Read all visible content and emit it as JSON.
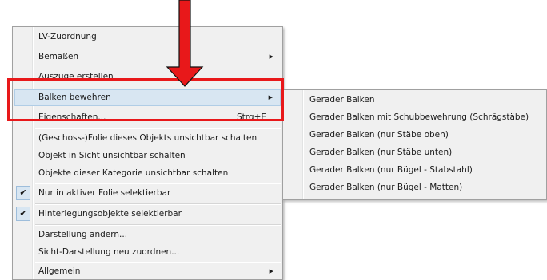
{
  "menu": {
    "items": [
      {
        "label": "LV-Zuordnung"
      },
      {
        "label": "Bemaßen",
        "submenu": true
      },
      {
        "label": "Auszüge erstellen"
      },
      {
        "label": "Balken bewehren",
        "submenu": true,
        "active": true
      },
      {
        "label": "Eigenschaften...",
        "shortcut": "Strg+E"
      },
      {
        "label": "(Geschoss-)Folie dieses Objekts unsichtbar schalten"
      },
      {
        "label": "Objekt in Sicht unsichtbar schalten"
      },
      {
        "label": "Objekte dieser Kategorie unsichtbar schalten"
      },
      {
        "label": "Nur in aktiver Folie selektierbar",
        "checked": true
      },
      {
        "label": "Hinterlegungsobjekte selektierbar",
        "checked": true
      },
      {
        "label": "Darstellung ändern..."
      },
      {
        "label": "Sicht-Darstellung neu zuordnen..."
      },
      {
        "label": "Allgemein",
        "submenu": true
      }
    ]
  },
  "submenu": {
    "items": [
      {
        "label": "Gerader Balken"
      },
      {
        "label": "Gerader Balken mit Schubbewehrung (Schrägstäbe)"
      },
      {
        "label": "Gerader Balken (nur Stäbe oben)"
      },
      {
        "label": "Gerader Balken (nur Stäbe unten)"
      },
      {
        "label": "Gerader Balken (nur Bügel - Stabstahl)"
      },
      {
        "label": "Gerader Balken (nur Bügel - Matten)"
      }
    ]
  },
  "glyphs": {
    "arrow": "▶",
    "check": "✔"
  },
  "colors": {
    "annotation": "#e8181a",
    "hover": "#d8e6f2",
    "menu_bg": "#f0f0f0"
  }
}
